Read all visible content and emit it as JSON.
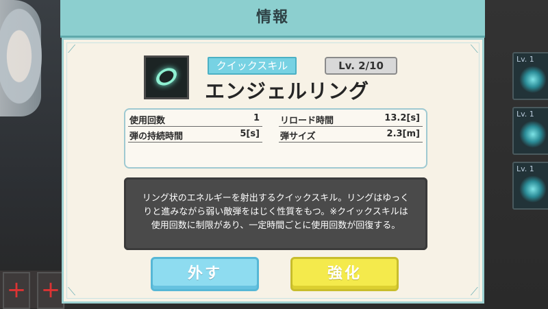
{
  "header": {
    "title": "情報"
  },
  "skill": {
    "category": "クイックスキル",
    "level": "Lv. 2/10",
    "name": "エンジェルリング",
    "icon": "angel-ring-icon"
  },
  "stats": [
    {
      "label": "使用回数",
      "value": "1"
    },
    {
      "label": "リロード時間",
      "value": "13.2[s]"
    },
    {
      "label": "弾の持続時間",
      "value": "5[s]"
    },
    {
      "label": "弾サイズ",
      "value": "2.3[m]"
    }
  ],
  "description": {
    "line1": "リング状のエネルギーを射出するクイックスキル。リングはゆっく",
    "line2": "りと進みながら弱い敵弾をはじく性質をもつ。※クイックスキルは",
    "line3": "使用回数に制限があり、一定時間ごとに使用回数が回復する。"
  },
  "buttons": {
    "remove": "外す",
    "upgrade": "強化"
  },
  "background": {
    "skill_cells": [
      "Lv. 1",
      "Lv. 1",
      "Lv. 1"
    ],
    "plus_symbol": "+"
  },
  "colors": {
    "title_bar": "#8ccfcf",
    "panel": "#f7f2e6",
    "category_badge": "#77d2e3",
    "remove_button": "#8edcf0",
    "upgrade_button": "#f4ea4c"
  }
}
